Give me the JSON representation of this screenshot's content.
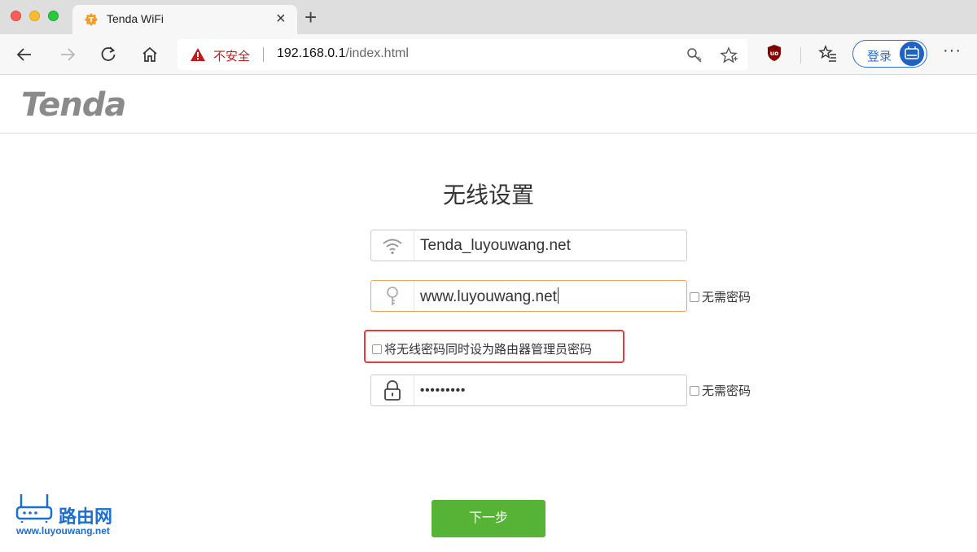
{
  "browser": {
    "tab_title": "Tenda WiFi",
    "tab_close": "×",
    "new_tab": "+",
    "security_label": "不安全",
    "url_host": "192.168.0.1",
    "url_path": "/index.html",
    "login_label": "登录",
    "more_label": "···",
    "icons": [
      "back-icon",
      "forward-icon",
      "refresh-icon",
      "home-icon",
      "warning-icon",
      "key-icon",
      "star-icon",
      "shield-extension-icon",
      "favorites-icon",
      "avatar-icon",
      "more-icon"
    ]
  },
  "header": {
    "logo_text": "Tenda"
  },
  "form": {
    "title": "无线设置",
    "ssid_value": "Tenda_luyouwang.net",
    "wifi_password_value": "www.luyouwang.net",
    "no_password_label": "无需密码",
    "sync_admin_label": "将无线密码同时设为路由器管理员密码",
    "admin_password_value": "•••••••••",
    "admin_no_password_label": "无需密码",
    "next_label": "下一步"
  },
  "watermark": {
    "cn_text": "路由网",
    "url_text": "www.luyouwang.net"
  },
  "colors": {
    "next_button": "#56b336",
    "focus_border": "#f5a25d",
    "highlight_box": "#e53a3e",
    "insecure_text": "#c4181a",
    "login_accent": "#2d6ed3",
    "watermark_blue": "#1a6fd0"
  }
}
